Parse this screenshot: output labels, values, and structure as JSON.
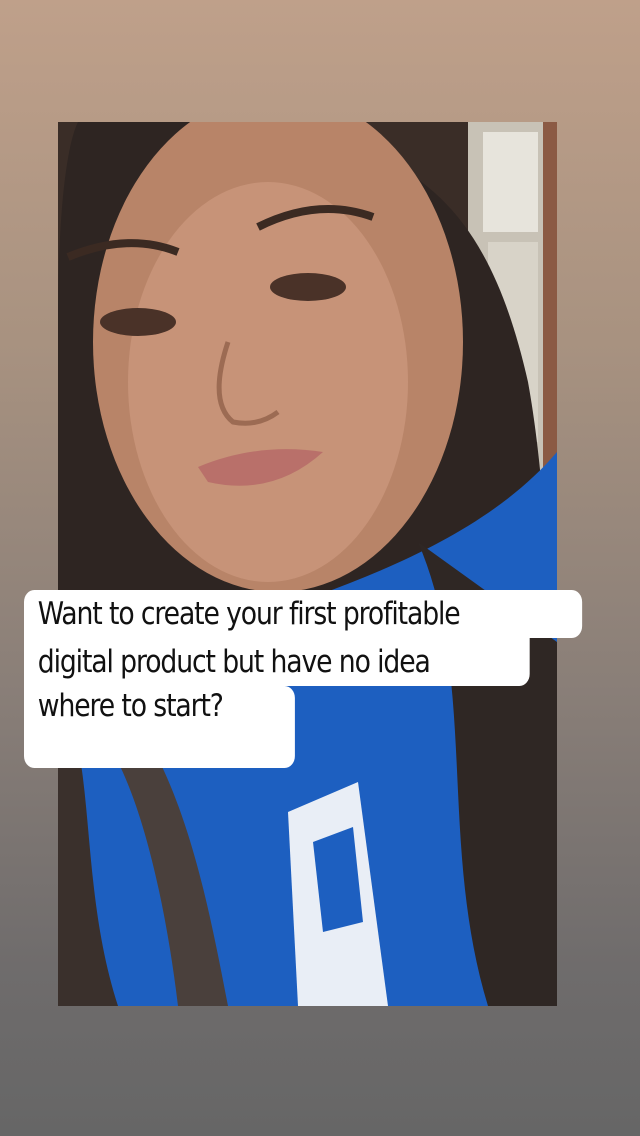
{
  "story": {
    "caption_lines": [
      "Want to create your first profitable",
      "digital product but have no idea",
      "where to start?"
    ]
  },
  "colors": {
    "background_top": "#bfa08a",
    "background_bottom": "#666666",
    "caption_bg": "#ffffff",
    "caption_text": "#111111",
    "shirt_blue": "#1d5fc0"
  }
}
